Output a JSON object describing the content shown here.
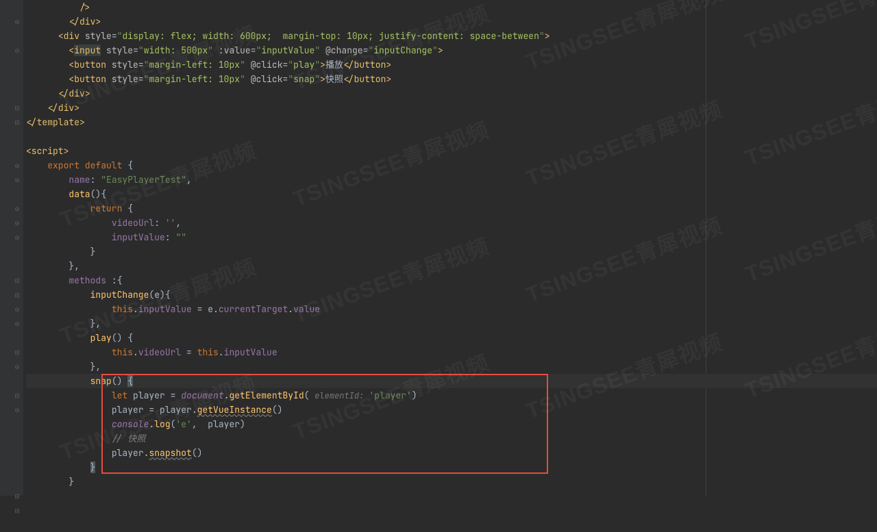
{
  "watermark_text": "TSINGSEE青犀视频",
  "gutter_folds": [
    "",
    "⊖",
    "",
    "⊖",
    "",
    "",
    "",
    "⊟",
    "⊟",
    "",
    "",
    "⊖",
    "⊖",
    "",
    "⊖",
    "⊖",
    "⊖",
    "",
    "",
    "⊟",
    "⊟",
    "⊖",
    "⊖",
    "",
    "⊟",
    "⊖",
    "",
    "⊟",
    "⊖",
    "",
    "",
    "",
    "",
    "",
    "⊟",
    "⊟",
    ""
  ],
  "lines": {
    "l0": "          />",
    "l1": "        </div>",
    "l2": "      <div style=\"display: flex; width: 600px;  margin-top: 10px; justify-content: space-between\">",
    "l3": "        <input style=\"width: 500px\" :value=\"inputValue\" @change=\"inputChange\">",
    "l4": "        <button style=\"margin-left: 10px\" @click=\"play\">播放</button>",
    "l5": "        <button style=\"margin-left: 10px\" @click=\"snap\">快照</button>",
    "l6": "      </div>",
    "l7": "    </div>",
    "l8": "</template>",
    "l9": "",
    "l10": "<script>",
    "l11": "    export default {",
    "l12": "        name: \"EasyPlayerTest\",",
    "l13": "        data(){",
    "l14": "            return {",
    "l15": "                videoUrl: '',",
    "l16": "                inputValue: \"\"",
    "l17": "            }",
    "l18": "        },",
    "l19": "        methods :{",
    "l20": "            inputChange(e){",
    "l21": "                this.inputValue = e.currentTarget.value",
    "l22": "            },",
    "l23": "            play() {",
    "l24": "                this.videoUrl = this.inputValue",
    "l25": "            },",
    "l26": "            snap() {",
    "l27": "                let player = document.getElementById( elementId: 'player')",
    "l28": "                player = player.getVueInstance()",
    "l29": "                console.log('e',  player)",
    "l30": "                // 快照",
    "l31": "                player.snapshot()",
    "l32": "            }",
    "l33": "        }",
    "l34": ""
  }
}
